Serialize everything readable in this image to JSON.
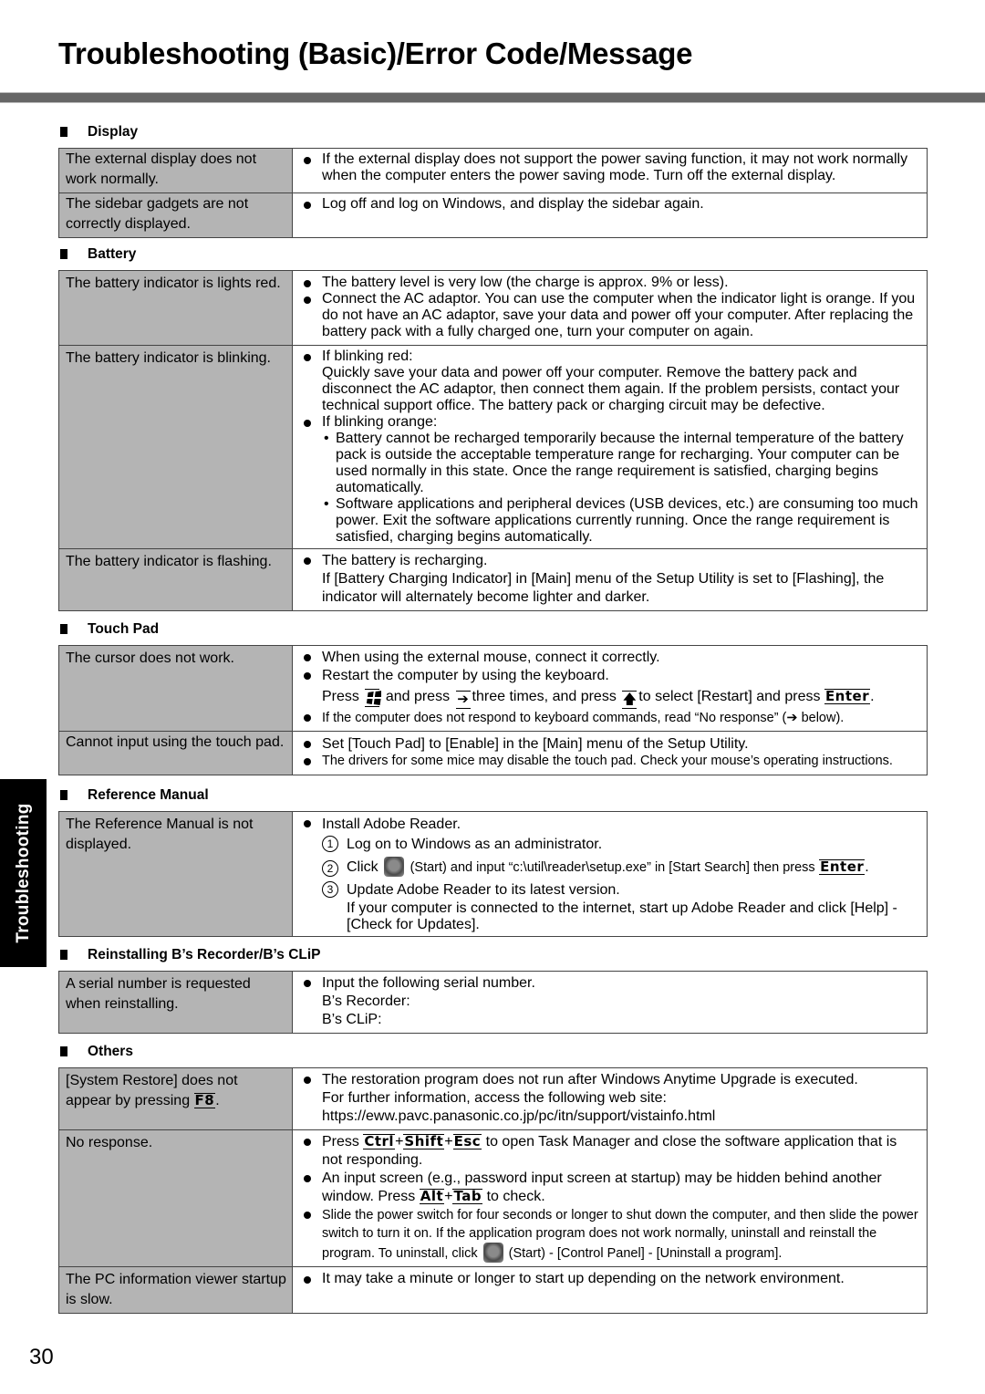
{
  "page": {
    "title": "Troubleshooting (Basic)/Error Code/Message",
    "side_tab": "Troubleshooting",
    "page_number": "30"
  },
  "colors": {
    "title_bar": "#666666",
    "symptom_cell": "#b4b4b4",
    "side_tab": "#000000"
  },
  "sections": {
    "display": {
      "heading": "Display",
      "rows": [
        {
          "symptom": "The external display does not work normally.",
          "fix": [
            "If the external display does not support the power saving function, it may not work normally when the computer enters the power saving mode. Turn off the external display."
          ]
        },
        {
          "symptom": "The sidebar gadgets are not correctly displayed.",
          "fix": [
            "Log off and log on Windows, and display the sidebar again."
          ]
        }
      ]
    },
    "battery": {
      "heading": "Battery",
      "rows": [
        {
          "symptom": "The battery indicator is lights red.",
          "fix": [
            "The battery level is very low (the charge is approx. 9% or less).",
            "Connect the AC adaptor. You can use the computer when the indicator light is orange. If you do not have an AC adaptor, save your data and power off your computer. After replacing the battery pack with a fully charged one, turn your computer on again."
          ]
        },
        {
          "symptom": "The battery indicator is blinking.",
          "fix": [
            "If blinking red:",
            "Quickly save your data and power off your computer. Remove the battery pack and disconnect the AC adaptor, then connect them again. If the problem persists, contact your technical support office. The battery pack or charging circuit may be defective.",
            "If blinking orange:",
            "Battery cannot be recharged temporarily because the internal temperature of the battery pack is outside the acceptable temperature range for recharging. Your computer can be used normally in this state. Once the range requirement is satisfied, charging begins automatically.",
            "Software applications and peripheral devices (USB devices, etc.) are consuming too much power. Exit the software applications currently running. Once the range requirement is satisfied, charging begins automatically."
          ]
        },
        {
          "symptom": "The battery indicator is flashing.",
          "fix": [
            "The battery is recharging.",
            "If [Battery Charging Indicator] in [Main] menu of the Setup Utility is set to [Flashing], the indicator will alternately become lighter and darker."
          ]
        }
      ]
    },
    "touchpad": {
      "heading": "Touch Pad",
      "rows": [
        {
          "symptom": "The cursor does not work.",
          "fix": {
            "b1": "When using the external mouse, connect it correctly.",
            "b2": "Restart the computer by using the keyboard.",
            "press": "Press",
            "and_press": "and press",
            "three_times": "three times, and press",
            "to_select": "to select [Restart] and press",
            "key_enter": "Enter",
            "period": ".",
            "b3_pre": "If the computer does not respond to keyboard commands, read “No response” (",
            "b3_post": " below)."
          }
        },
        {
          "symptom": "Cannot input using the touch pad.",
          "fix": [
            "Set [Touch Pad] to [Enable] in the [Main] menu of the Setup Utility.",
            "The drivers for some mice may disable the touch pad. Check your mouse’s operating instructions."
          ]
        }
      ]
    },
    "reference": {
      "heading": "Reference Manual",
      "rows": [
        {
          "symptom": "The Reference Manual is not displayed.",
          "fix": {
            "b1": "Install Adobe Reader.",
            "s1_num": "1",
            "s1": "Log on to Windows as an administrator.",
            "s2_num": "2",
            "s2_pre": "Click",
            "s2_post": "(Start) and input “c:\\util\\reader\\setup.exe” in [Start Search] then press",
            "key_enter": "Enter",
            "period": ".",
            "s3_num": "3",
            "s3": "Update Adobe Reader to its latest version.",
            "s3_note": "If your computer is connected to the internet, start up Adobe Reader and click [Help] - [Check for Updates]."
          }
        }
      ]
    },
    "reinstall": {
      "heading": "Reinstalling B’s Recorder/B’s CLiP",
      "rows": [
        {
          "symptom": "A serial number is requested when reinstalling.",
          "fix": [
            "Input the following serial number.",
            "B’s Recorder:",
            "B’s CLiP:"
          ]
        }
      ]
    },
    "others": {
      "heading": "Others",
      "rows": [
        {
          "symptom_pre": "[System Restore] does not appear by pressing",
          "symptom_key": "F8",
          "symptom_post": ".",
          "fix": [
            "The restoration program does not run after Windows Anytime Upgrade is executed.",
            "For further information, access the following web site:",
            "https://eww.pavc.panasonic.co.jp/pc/itn/support/vistainfo.html"
          ]
        },
        {
          "symptom": "No response.",
          "fix": {
            "b1_pre": "Press",
            "k_ctrl": "Ctrl",
            "plus": "+",
            "k_shift": "Shift",
            "k_esc": "Esc",
            "b1_post": "to open Task Manager and close the software application that is not responding.",
            "b2_pre": "An input screen (e.g., password input screen at startup) may be hidden behind another window. Press",
            "k_alt": "Alt",
            "k_tab": "Tab",
            "b2_post": "to check.",
            "b3_pre": "Slide the power switch for four seconds or longer to shut down the computer, and then slide the power switch to turn it on. If the application program does not work normally, uninstall and reinstall the program. To uninstall, click",
            "b3_post": "(Start) - [Control Panel] - [Uninstall a program]."
          }
        },
        {
          "symptom": "The PC information viewer startup is slow.",
          "fix": [
            "It may take a minute or longer to start up depending on the network environment."
          ]
        }
      ]
    }
  }
}
